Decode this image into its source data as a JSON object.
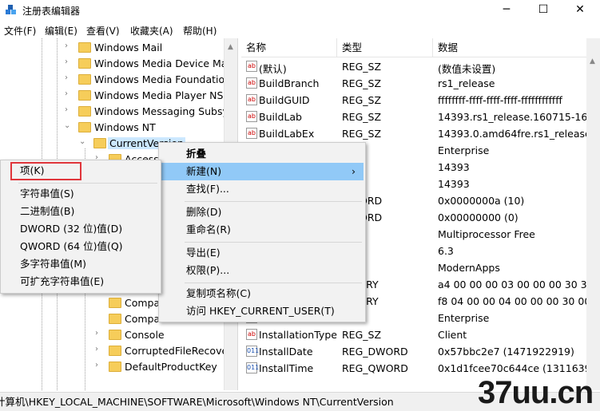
{
  "window": {
    "title": "注册表编辑器",
    "buttons": {
      "minimize": "─",
      "maximize": "☐",
      "close": "✕"
    }
  },
  "menu": [
    "文件(F)",
    "编辑(E)",
    "查看(V)",
    "收藏夹(A)",
    "帮助(H)"
  ],
  "tree": {
    "items": [
      {
        "label": "Windows Mail",
        "expanded": false
      },
      {
        "label": "Windows Media Device Ma",
        "expanded": false
      },
      {
        "label": "Windows Media Foundatior",
        "expanded": false
      },
      {
        "label": "Windows Media Player NSS",
        "expanded": false
      },
      {
        "label": "Windows Messaging Subsy",
        "expanded": false
      },
      {
        "label": "Windows NT",
        "expanded": true
      },
      {
        "label": "CurrentVersion",
        "expanded": true,
        "selected": true
      },
      {
        "label": "Accessi",
        "expanded": false
      },
      {
        "label": "Compa",
        "expanded": false
      },
      {
        "label": "Compa",
        "expanded": false
      },
      {
        "label": "Console",
        "expanded": false
      },
      {
        "label": "CorruptedFileRecove",
        "expanded": false
      },
      {
        "label": "DefaultProductKey",
        "expanded": false
      }
    ]
  },
  "list": {
    "headers": {
      "name": "名称",
      "type": "类型",
      "data": "数据"
    },
    "rows": [
      {
        "icon": "string-value-icon",
        "name": "(默认)",
        "type": "REG_SZ",
        "data": "(数值未设置)"
      },
      {
        "icon": "string-value-icon",
        "name": "BuildBranch",
        "type": "REG_SZ",
        "data": "rs1_release"
      },
      {
        "icon": "string-value-icon",
        "name": "BuildGUID",
        "type": "REG_SZ",
        "data": "ffffffff-ffff-ffff-ffff-ffffffffffff"
      },
      {
        "icon": "string-value-icon",
        "name": "BuildLab",
        "type": "REG_SZ",
        "data": "14393.rs1_release.160715-1616"
      },
      {
        "icon": "string-value-icon",
        "name": "BuildLabEx",
        "type": "REG_SZ",
        "data": "14393.0.amd64fre.rs1_release.1607"
      },
      {
        "icon": "string-value-icon",
        "name": "",
        "type": "SZ",
        "data": "Enterprise"
      },
      {
        "icon": "string-value-icon",
        "name": "",
        "type": "SZ",
        "data": "14393"
      },
      {
        "icon": "string-value-icon",
        "name": "",
        "type": "SZ",
        "data": "14393"
      },
      {
        "icon": "binary-value-icon",
        "name": "",
        "type": "DWORD",
        "data": "0x0000000a (10)"
      },
      {
        "icon": "binary-value-icon",
        "name": "",
        "type": "DWORD",
        "data": "0x00000000 (0)"
      },
      {
        "icon": "string-value-icon",
        "name": "",
        "type": "SZ",
        "data": "Multiprocessor Free"
      },
      {
        "icon": "string-value-icon",
        "name": "",
        "type": "SZ",
        "data": "6.3"
      },
      {
        "icon": "string-value-icon",
        "name": "",
        "type": "SZ",
        "data": "ModernApps"
      },
      {
        "icon": "binary-value-icon",
        "name": "",
        "type": "BINARY",
        "data": "a4 00 00 00 03 00 00 00 30 30 3"
      },
      {
        "icon": "binary-value-icon",
        "name": "",
        "type": "BINARY",
        "data": "f8 04 00 00 04 00 00 00 30 00 3"
      },
      {
        "icon": "string-value-icon",
        "name": "",
        "type": "SZ",
        "data": "Enterprise"
      },
      {
        "icon": "string-value-icon",
        "name": "InstallationType",
        "type": "REG_SZ",
        "data": "Client"
      },
      {
        "icon": "binary-value-icon",
        "name": "InstallDate",
        "type": "REG_DWORD",
        "data": "0x57bbc2e7 (1471922919)"
      },
      {
        "icon": "binary-value-icon",
        "name": "InstallTime",
        "type": "REG_QWORD",
        "data": "0x1d1fcee70c644ce (131163965"
      }
    ]
  },
  "statusbar": {
    "path": "计算机\\HKEY_LOCAL_MACHINE\\SOFTWARE\\Microsoft\\Windows NT\\CurrentVersion"
  },
  "context_menu": {
    "items": [
      "折叠",
      "新建(N)",
      "查找(F)...",
      "删除(D)",
      "重命名(R)",
      "导出(E)",
      "权限(P)...",
      "复制项名称(C)",
      "访问 HKEY_CURRENT_USER(T)"
    ],
    "submenu_arrow": "›"
  },
  "submenu": {
    "items": [
      "项(K)",
      "字符串值(S)",
      "二进制值(B)",
      "DWORD (32 位)值(D)",
      "QWORD (64 位)值(Q)",
      "多字符串值(M)",
      "可扩充字符串值(E)"
    ]
  },
  "watermark": "37uu.cn",
  "colors": {
    "highlight": "#91c9f7",
    "selected": "#cce8ff",
    "annotation_box": "#e0353b",
    "folder": "#f6cd5a"
  }
}
